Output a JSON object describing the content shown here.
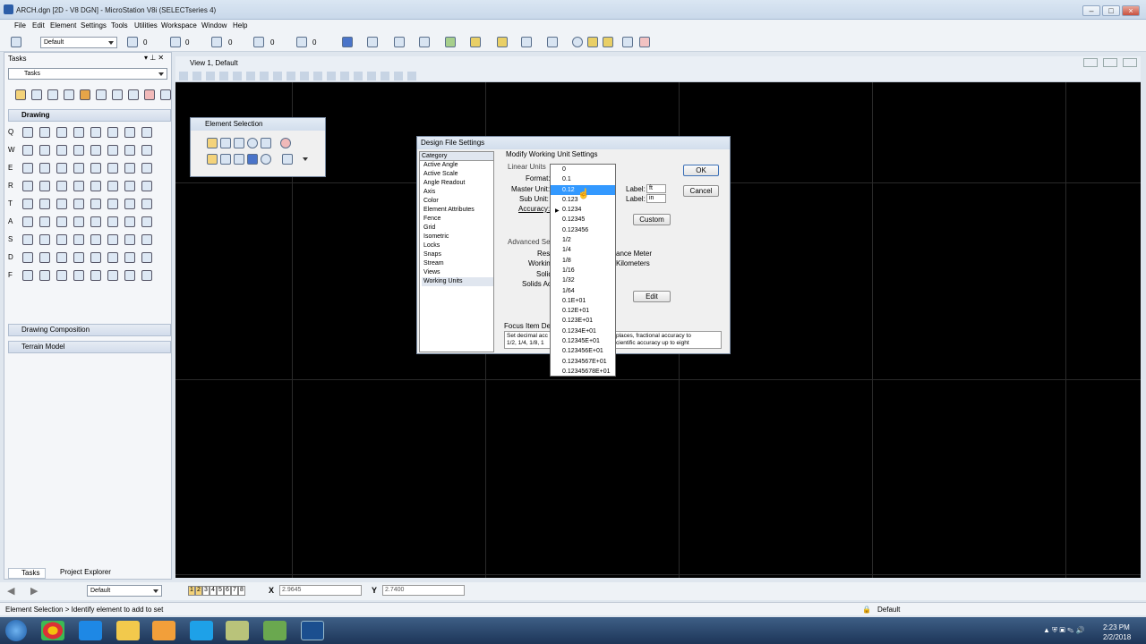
{
  "window": {
    "title": "ARCH.dgn [2D - V8 DGN] - MicroStation V8i (SELECTseries 4)"
  },
  "menu": [
    "File",
    "Edit",
    "Element",
    "Settings",
    "Tools",
    "Utilities",
    "Workspace",
    "Window",
    "Help"
  ],
  "toolbar": {
    "level": "Default",
    "counts": [
      "0",
      "0",
      "0",
      "0",
      "0"
    ]
  },
  "tasks": {
    "header": "Tasks",
    "combo": "Tasks",
    "drawing": "Drawing",
    "row_labels": [
      "Q",
      "W",
      "E",
      "R",
      "T",
      "A",
      "S",
      "D",
      "F"
    ],
    "sections": [
      "Drawing Composition",
      "Terrain Model"
    ],
    "tabs": [
      "Tasks",
      "Project Explorer"
    ]
  },
  "view": {
    "title": "View 1, Default"
  },
  "element_selection": {
    "title": "Element Selection"
  },
  "dialog": {
    "title": "Design File Settings",
    "category_header": "Category",
    "categories": [
      "Active Angle",
      "Active Scale",
      "Angle Readout",
      "Axis",
      "Color",
      "Element Attributes",
      "Fence",
      "Grid",
      "Isometric",
      "Locks",
      "Snaps",
      "Stream",
      "Views",
      "Working Units"
    ],
    "selected_category": "Working Units",
    "section_title": "Modify Working Unit Settings",
    "linear_units": "Linear Units",
    "format_label": "Format:",
    "master_unit_label": "Master Unit:",
    "sub_unit_label": "Sub Unit:",
    "accuracy_label": "Accuracy:",
    "label1": "Label:",
    "label1_value": "ft",
    "label2": "Label:",
    "label2_value": "in",
    "custom": "Custom",
    "advanced": "Advanced Sett",
    "res": "Res",
    "working": "Working",
    "solid": "Solid",
    "solids_acc": "Solids Acc",
    "ance_meter": "ance Meter",
    "kilometers": "Kilometers",
    "edit": "Edit",
    "focus_label": "Focus Item Desc",
    "focus_text_left": "Set decimal acc\n1/2, 1/4, 1/8, 1",
    "focus_text_right": "places, fractional accuracy to\ncientific accuracy up to eight",
    "ok": "OK",
    "cancel": "Cancel"
  },
  "accuracy_options": [
    "0",
    "0.1",
    "0.12",
    "0.123",
    "0.1234",
    "0.12345",
    "0.123456",
    "1/2",
    "1/4",
    "1/8",
    "1/16",
    "1/32",
    "1/64",
    "0.1E+01",
    "0.12E+01",
    "0.123E+01",
    "0.1234E+01",
    "0.12345E+01",
    "0.123456E+01",
    "0.1234567E+01",
    "0.12345678E+01"
  ],
  "accuracy_selected": "0.12",
  "coords": {
    "x_label": "X",
    "x": "2.9645",
    "y_label": "Y",
    "y": "2.7400",
    "level": "Default",
    "views": [
      "1",
      "2",
      "3",
      "4",
      "5",
      "6",
      "7",
      "8"
    ]
  },
  "status": {
    "left": "Element Selection > Identify element to add to set",
    "right": "Default"
  },
  "clock": {
    "time": "2:23 PM",
    "date": "2/2/2018"
  }
}
